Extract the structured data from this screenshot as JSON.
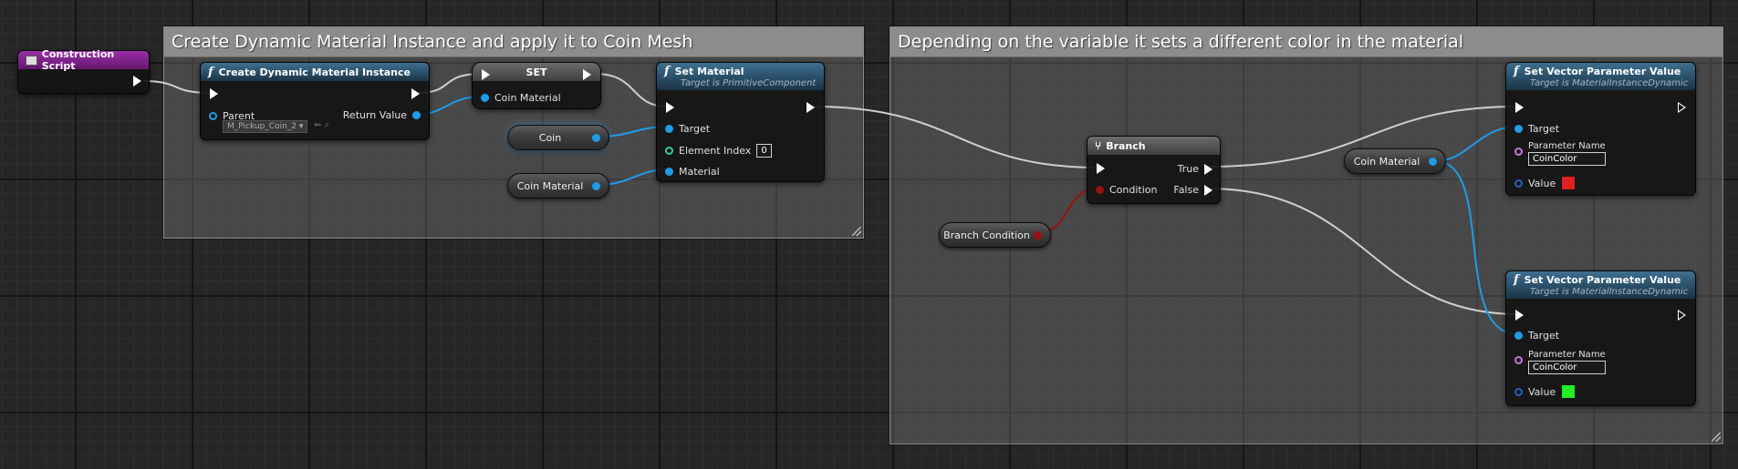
{
  "comments": [
    {
      "title": "Create Dynamic Material Instance and apply it to Coin Mesh"
    },
    {
      "title": "Depending on the variable it sets a different color in the material"
    }
  ],
  "construction_script": {
    "title": "Construction Script"
  },
  "create_dmi": {
    "title": "Create Dynamic Material Instance",
    "parent_label": "Parent",
    "parent_value": "M_Pickup_Coin_2",
    "return_label": "Return Value"
  },
  "set_node": {
    "title": "SET",
    "pin_label": "Coin Material"
  },
  "set_material": {
    "title": "Set Material",
    "subtitle": "Target is PrimitiveComponent",
    "target_label": "Target",
    "element_index_label": "Element Index",
    "element_index_value": "0",
    "material_label": "Material"
  },
  "vars": {
    "coin": "Coin",
    "coin_material_1": "Coin Material",
    "coin_material_2": "Coin Material",
    "branch_condition": "Branch Condition"
  },
  "branch": {
    "title": "Branch",
    "condition_label": "Condition",
    "true_label": "True",
    "false_label": "False"
  },
  "svp_nodes": [
    {
      "title": "Set Vector Parameter Value",
      "subtitle": "Target is MaterialInstanceDynamic",
      "target_label": "Target",
      "param_name_label": "Parameter Name",
      "param_name_value": "CoinColor",
      "value_label": "Value",
      "color": "#e02020"
    },
    {
      "title": "Set Vector Parameter Value",
      "subtitle": "Target is MaterialInstanceDynamic",
      "target_label": "Target",
      "param_name_label": "Parameter Name",
      "param_name_value": "CoinColor",
      "value_label": "Value",
      "color": "#22ee22"
    }
  ],
  "colors": {
    "exec_wire": "#cfcfcf",
    "object_wire": "#1f9ce8",
    "bool_wire": "#9a0f0f"
  }
}
